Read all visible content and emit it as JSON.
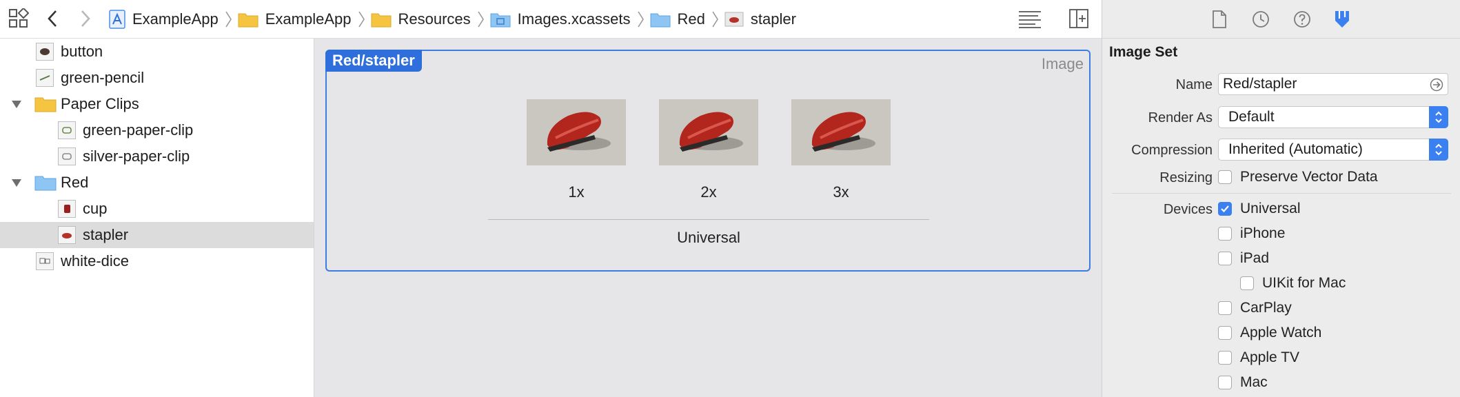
{
  "colors": {
    "accent": "#3b80f1",
    "selection_tag": "#2f6fdc",
    "folder": "#f5c542",
    "blue_folder": "#8ec5f2"
  },
  "jumpbar": {
    "breadcrumbs": [
      {
        "label": "ExampleApp",
        "icon": "app-project-icon"
      },
      {
        "label": "ExampleApp",
        "icon": "folder-icon"
      },
      {
        "label": "Resources",
        "icon": "folder-icon"
      },
      {
        "label": "Images.xcassets",
        "icon": "asset-catalog-icon"
      },
      {
        "label": "Red",
        "icon": "blue-folder-icon"
      },
      {
        "label": "stapler",
        "icon": "image-thumbnail-icon"
      }
    ]
  },
  "navigator": {
    "items": [
      {
        "label": "button",
        "kind": "image"
      },
      {
        "label": "green-pencil",
        "kind": "image"
      },
      {
        "label": "Paper Clips",
        "kind": "folder",
        "expanded": true
      },
      {
        "label": "green-paper-clip",
        "kind": "image"
      },
      {
        "label": "silver-paper-clip",
        "kind": "image"
      },
      {
        "label": "Red",
        "kind": "blue-folder",
        "expanded": true
      },
      {
        "label": "cup",
        "kind": "image"
      },
      {
        "label": "stapler",
        "kind": "image",
        "selected": true
      },
      {
        "label": "white-dice",
        "kind": "image"
      }
    ]
  },
  "editor": {
    "set_name": "Red/stapler",
    "set_kind": "Image",
    "scales": [
      "1x",
      "2x",
      "3x"
    ],
    "idiom": "Universal"
  },
  "inspector": {
    "section_title": "Image Set",
    "name_label": "Name",
    "name_value": "Red/stapler",
    "render_as_label": "Render As",
    "render_as_value": "Default",
    "compression_label": "Compression",
    "compression_value": "Inherited (Automatic)",
    "resizing_label": "Resizing",
    "preserve_vector_label": "Preserve Vector Data",
    "preserve_vector_checked": false,
    "devices_label": "Devices",
    "devices": [
      {
        "label": "Universal",
        "checked": true
      },
      {
        "label": "iPhone",
        "checked": false
      },
      {
        "label": "iPad",
        "checked": false
      },
      {
        "label": "UIKit for Mac",
        "checked": false
      },
      {
        "label": "CarPlay",
        "checked": false
      },
      {
        "label": "Apple Watch",
        "checked": false
      },
      {
        "label": "Apple TV",
        "checked": false
      },
      {
        "label": "Mac",
        "checked": false
      }
    ]
  }
}
